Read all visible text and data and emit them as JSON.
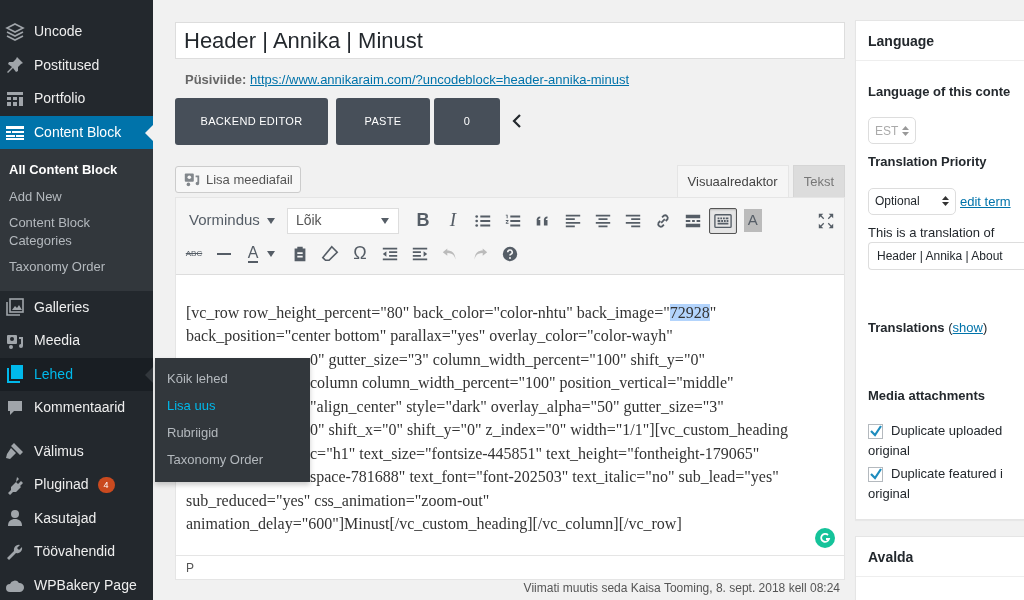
{
  "sidebar": {
    "items": [
      {
        "label": "Uncode",
        "current": false,
        "hovered": false
      },
      {
        "label": "Postitused",
        "current": false,
        "hovered": false
      },
      {
        "label": "Portfolio",
        "current": false,
        "hovered": false
      },
      {
        "label": "Content Block",
        "current": true,
        "hovered": false,
        "submenu": [
          {
            "label": "All Content Block",
            "selected": true
          },
          {
            "label": "Add New",
            "selected": false
          },
          {
            "label": "Content Block Categories",
            "selected": false
          },
          {
            "label": "Taxonomy Order",
            "selected": false
          }
        ]
      },
      {
        "label": "Galleries",
        "current": false,
        "hovered": false
      },
      {
        "label": "Meedia",
        "current": false,
        "hovered": false
      },
      {
        "label": "Lehed",
        "current": false,
        "hovered": true,
        "flyout": [
          {
            "label": "Kõik lehed",
            "selected": false
          },
          {
            "label": "Lisa uus",
            "selected": true
          },
          {
            "label": "Rubriigid",
            "selected": false
          },
          {
            "label": "Taxonomy Order",
            "selected": false
          }
        ]
      },
      {
        "label": "Kommentaarid",
        "current": false,
        "hovered": false
      },
      {
        "label": "Välimus",
        "current": false,
        "hovered": false
      },
      {
        "label": "Pluginad",
        "current": false,
        "hovered": false,
        "badge": "4"
      },
      {
        "label": "Kasutajad",
        "current": false,
        "hovered": false
      },
      {
        "label": "Töövahendid",
        "current": false,
        "hovered": false
      },
      {
        "label": "WPBakery Page",
        "current": false,
        "hovered": false
      }
    ]
  },
  "title_field": {
    "value": "Header | Annika | Minust"
  },
  "permalink": {
    "label": "Püsiviide:",
    "url": "https://www.annikaraim.com/?uncodeblock=header-annika-minust"
  },
  "builder_buttons": [
    "BACKEND EDITOR",
    "PASTE",
    "0"
  ],
  "add_media": "Lisa meediafail",
  "editor_tabs": [
    {
      "label": "Visuaalredaktor",
      "selected": true
    },
    {
      "label": "Tekst",
      "selected": false
    }
  ],
  "toolbar_rows": [
    [
      {
        "kind": "dropdown",
        "label": "Vormindus"
      },
      {
        "kind": "select",
        "label": "Lõik"
      },
      {
        "kind": "letter",
        "label": "B"
      },
      {
        "kind": "letter",
        "label": "I"
      },
      {
        "kind": "icon"
      },
      {
        "kind": "icon"
      },
      {
        "kind": "icon"
      },
      {
        "kind": "icon"
      },
      {
        "kind": "icon"
      },
      {
        "kind": "icon"
      },
      {
        "kind": "icon"
      },
      {
        "kind": "icon"
      },
      {
        "kind": "icon",
        "pressed": true
      },
      {
        "kind": "letter",
        "label": "A"
      },
      {
        "kind": "spacer"
      },
      {
        "kind": "icon"
      }
    ],
    [
      {
        "kind": "letter",
        "label": "ABC"
      },
      {
        "kind": "icon"
      },
      {
        "kind": "letter",
        "label": "A"
      },
      {
        "kind": "icon"
      },
      {
        "kind": "icon"
      },
      {
        "kind": "letter",
        "label": "Ω"
      },
      {
        "kind": "icon"
      },
      {
        "kind": "icon"
      },
      {
        "kind": "icon",
        "disabled": true
      },
      {
        "kind": "icon",
        "disabled": true
      },
      {
        "kind": "icon"
      }
    ]
  ],
  "editor_lines": [
    {
      "parts": [
        {
          "text": "[vc_row row_height_percent=\"80\" back_color=\"color-nhtu\" back_image=\"",
          "selected": false
        },
        {
          "text": "72928",
          "selected": true
        },
        {
          "text": "\"",
          "selected": false
        }
      ]
    },
    {
      "parts": [
        {
          "text": "back_position=\"center bottom\" parallax=\"yes\" overlay_color=\"color-wayh\"",
          "selected": false
        }
      ]
    },
    {
      "covered": true,
      "parts": [
        {
          "text": "0\" gutter_size=\"3\" column_width_percent=\"100\" shift_y=\"0\"",
          "selected": false
        }
      ]
    },
    {
      "covered": true,
      "parts": [
        {
          "text": "column column_width_percent=\"100\" position_vertical=\"middle\"",
          "selected": false
        }
      ]
    },
    {
      "covered": true,
      "parts": [
        {
          "text": "\"align_center\" style=\"dark\" overlay_alpha=\"50\" gutter_size=\"3\"",
          "selected": false
        }
      ]
    },
    {
      "covered": true,
      "parts": [
        {
          "text": "0\" shift_x=\"0\" shift_y=\"0\" z_index=\"0\" width=\"1/1\"][vc_custom_heading",
          "selected": false
        }
      ]
    },
    {
      "covered": true,
      "parts": [
        {
          "text": "c=\"h1\" text_size=\"fontsize-445851\" text_height=\"fontheight-179065\"",
          "selected": false
        }
      ]
    },
    {
      "covered": true,
      "parts": [
        {
          "text": "space-781688\" text_font=\"font-202503\" text_italic=\"no\" sub_lead=\"yes\"",
          "selected": false
        }
      ]
    },
    {
      "parts": [
        {
          "text": "sub_reduced=\"yes\" css_animation=\"zoom-out\"",
          "selected": false
        }
      ]
    },
    {
      "parts": [
        {
          "text": "animation_delay=\"600\"]Minust[/vc_custom_heading][/vc_column][/vc_row]",
          "selected": false
        }
      ]
    }
  ],
  "editor_path": "P",
  "last_edited": "Viimati muutis seda Kaisa Tooming, 8. sept. 2018 kell 08:24",
  "language_box": {
    "title": "Language",
    "content_label": "Language of this conte",
    "language_select": "EST",
    "priority_label": "Translation Priority",
    "priority_select": "Optional",
    "edit_terms_link": "edit term",
    "translation_of_label": "This is a translation of",
    "translation_of_value": "Header | Annika | About",
    "translations_label": "Translations",
    "paren_open": "(",
    "show_link": "show",
    "paren_close": ")",
    "media_label": "Media attachments",
    "checkboxes": [
      {
        "label": "Duplicate uploaded",
        "continuation": "original",
        "checked": true
      },
      {
        "label": "Duplicate featured i",
        "continuation": "original",
        "checked": true
      }
    ]
  },
  "publish_box": {
    "title": "Avalda"
  }
}
